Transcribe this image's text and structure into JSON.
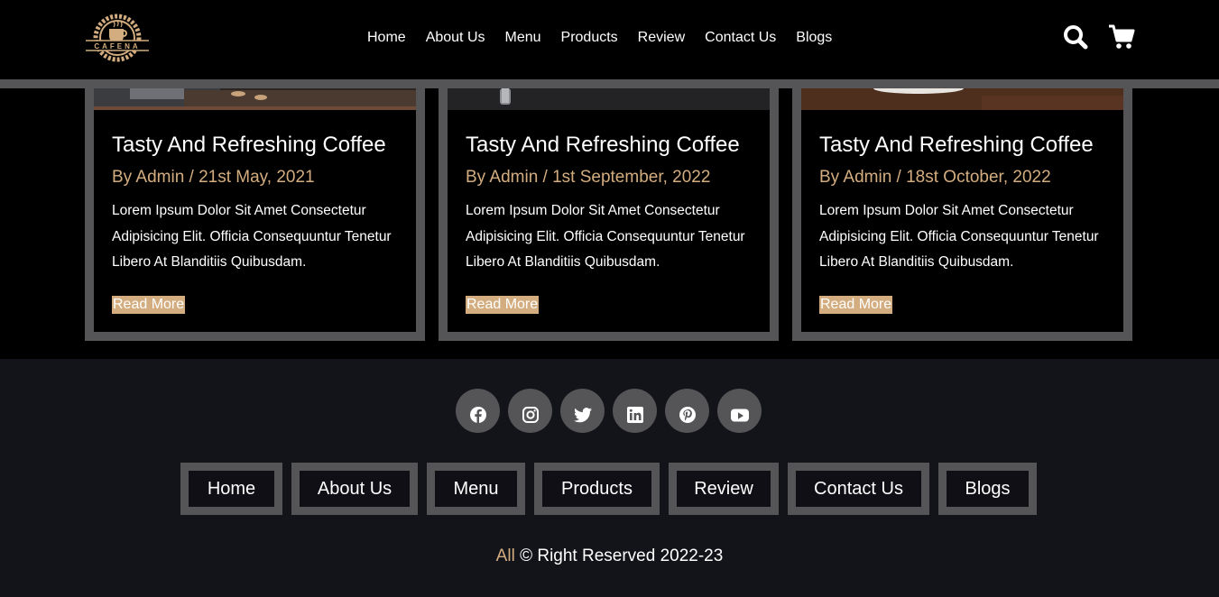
{
  "header": {
    "logo_text": "CAFENA",
    "nav": [
      "Home",
      "About Us",
      "Menu",
      "Products",
      "Review",
      "Contact Us",
      "Blogs"
    ],
    "icons": [
      "search-icon",
      "cart-icon"
    ]
  },
  "blogs": [
    {
      "title": "Tasty And Refreshing Coffee",
      "meta": "By Admin / 21st May, 2021",
      "text": "Lorem Ipsum Dolor Sit Amet Consectetur Adipisicing Elit. Officia Consequuntur Tenetur Libero At Blanditiis Quibusdam.",
      "read_more": "Read More"
    },
    {
      "title": "Tasty And Refreshing Coffee",
      "meta": "By Admin / 1st September, 2022",
      "text": "Lorem Ipsum Dolor Sit Amet Consectetur Adipisicing Elit. Officia Consequuntur Tenetur Libero At Blanditiis Quibusdam.",
      "read_more": "Read More"
    },
    {
      "title": "Tasty And Refreshing Coffee",
      "meta": "By Admin / 18st October, 2022",
      "text": "Lorem Ipsum Dolor Sit Amet Consectetur Adipisicing Elit. Officia Consequuntur Tenetur Libero At Blanditiis Quibusdam.",
      "read_more": "Read More"
    }
  ],
  "footer": {
    "socials": [
      "facebook-icon",
      "instagram-icon",
      "twitter-icon",
      "linkedin-icon",
      "pinterest-icon",
      "youtube-icon"
    ],
    "nav": [
      "Home",
      "About Us",
      "Menu",
      "Products",
      "Review",
      "Contact Us",
      "Blogs"
    ],
    "copyright_accent": "All",
    "copyright_rest": " © Right Reserved 2022-23"
  },
  "colors": {
    "accent": "#d3ad7f",
    "border": "#555457",
    "footer_bg": "#13131a"
  }
}
